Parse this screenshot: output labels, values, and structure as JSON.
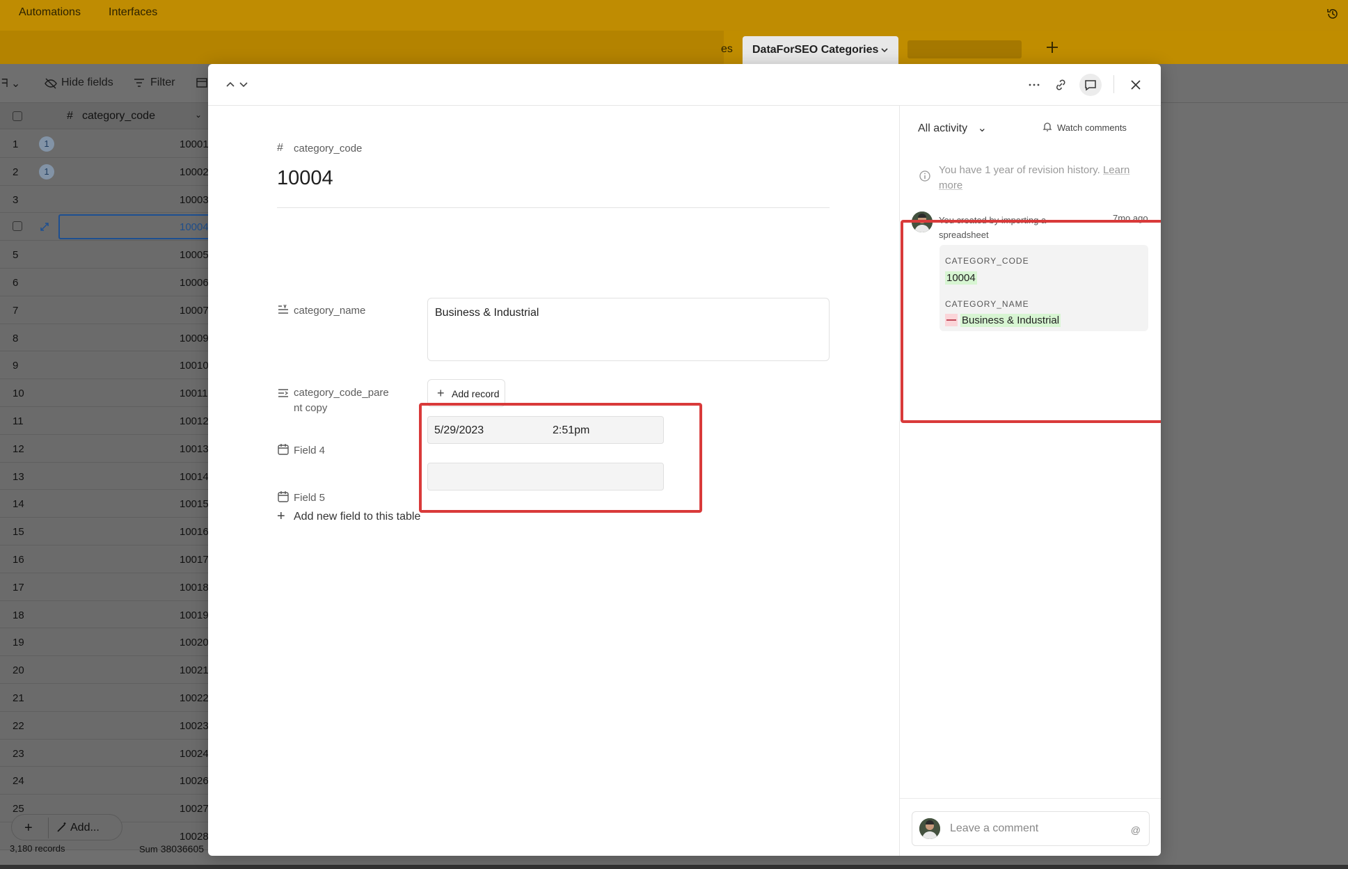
{
  "appbar": {
    "nav": [
      "Automations",
      "Interfaces"
    ]
  },
  "tabs": {
    "partial_label": "es",
    "active_label": "DataForSEO Categories"
  },
  "toolbar": {
    "hide_fields": "Hide fields",
    "filter": "Filter"
  },
  "grid": {
    "column_header": "category_code",
    "rows": [
      {
        "n": "1",
        "v": "10001",
        "badge": "1"
      },
      {
        "n": "2",
        "v": "10002",
        "badge": "1"
      },
      {
        "n": "3",
        "v": "10003",
        "badge": ""
      },
      {
        "n": "",
        "v": "10004",
        "badge": ""
      },
      {
        "n": "5",
        "v": "10005",
        "badge": ""
      },
      {
        "n": "6",
        "v": "10006",
        "badge": ""
      },
      {
        "n": "7",
        "v": "10007",
        "badge": ""
      },
      {
        "n": "8",
        "v": "10009",
        "badge": ""
      },
      {
        "n": "9",
        "v": "10010",
        "badge": ""
      },
      {
        "n": "10",
        "v": "10011",
        "badge": ""
      },
      {
        "n": "11",
        "v": "10012",
        "badge": ""
      },
      {
        "n": "12",
        "v": "10013",
        "badge": ""
      },
      {
        "n": "13",
        "v": "10014",
        "badge": ""
      },
      {
        "n": "14",
        "v": "10015",
        "badge": ""
      },
      {
        "n": "15",
        "v": "10016",
        "badge": ""
      },
      {
        "n": "16",
        "v": "10017",
        "badge": ""
      },
      {
        "n": "17",
        "v": "10018",
        "badge": ""
      },
      {
        "n": "18",
        "v": "10019",
        "badge": ""
      },
      {
        "n": "19",
        "v": "10020",
        "badge": ""
      },
      {
        "n": "20",
        "v": "10021",
        "badge": ""
      },
      {
        "n": "21",
        "v": "10022",
        "badge": ""
      },
      {
        "n": "22",
        "v": "10023",
        "badge": ""
      },
      {
        "n": "23",
        "v": "10024",
        "badge": ""
      },
      {
        "n": "24",
        "v": "10026",
        "badge": ""
      },
      {
        "n": "25",
        "v": "10027",
        "badge": ""
      },
      {
        "n": "",
        "v": "10028",
        "badge": ""
      }
    ],
    "add_label": "Add...",
    "records_count": "3,180 records",
    "sum_label": "Sum",
    "sum_value": "38036605"
  },
  "record": {
    "primary_field_label": "category_code",
    "primary_value": "10004",
    "fields": {
      "category_name_label": "category_name",
      "category_name_value": "Business & Industrial",
      "parent_label_line1": "category_code_pare",
      "parent_label_line2": "nt copy",
      "add_record_label": "Add record",
      "field4_label": "Field 4",
      "field4_date": "5/29/2023",
      "field4_time": "2:51pm",
      "field5_label": "Field 5"
    },
    "add_field_label": "Add new field to this table"
  },
  "activity": {
    "filter_label": "All activity",
    "watch_label": "Watch comments",
    "revision_note": "You have 1 year of revision history.",
    "revision_link_1": "Learn",
    "revision_link_2": "more",
    "entry_text": "You created by importing a spreadsheet",
    "entry_time": "7mo ago",
    "change1_label": "CATEGORY_CODE",
    "change1_value": "10004",
    "change2_label": "CATEGORY_NAME",
    "change2_value": "Business & Industrial",
    "comment_placeholder": "Leave a comment",
    "comment_at": "@"
  },
  "colors": {
    "appbar": "#bf8c02",
    "highlight": "#d93a3a",
    "added_bg": "#d7f5d2",
    "removed_bg": "#fbd5d9"
  }
}
